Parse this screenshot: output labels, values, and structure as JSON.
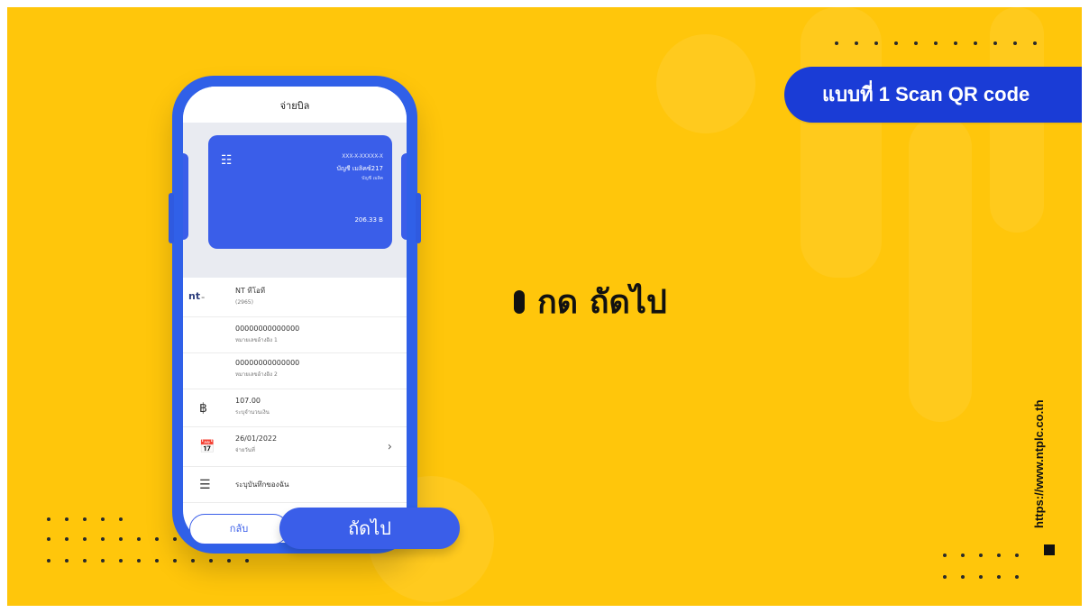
{
  "badge": {
    "prefix": "แบบที่ 1 Scan ",
    "bold": "QR code"
  },
  "instruction": {
    "text": "กด ถัดไป"
  },
  "website": "https://www.ntplc.co.th",
  "phone": {
    "header_title": "จ่ายบิล",
    "card": {
      "account_number": "XXX-X-XXXXX-X",
      "account_name": "บัญชี เมลิคซ์217",
      "account_type": "บัญชี เมลิค",
      "balance": "206.33 B"
    },
    "biller": {
      "name": "NT ทีโอที",
      "code": "(2965)",
      "logo": "nt"
    },
    "ref1": {
      "value": "00000000000000",
      "label": "หมายเลขอ้างอิง 1"
    },
    "ref2": {
      "value": "00000000000000",
      "label": "หมายเลขอ้างอิง 2"
    },
    "amount": {
      "value": "107.00",
      "label": "ระบุจำนวนเงิน"
    },
    "date": {
      "value": "26/01/2022",
      "label": "จ่ายวันที่"
    },
    "note": {
      "label": "ระบุบันทึกของฉัน"
    },
    "back_label": "กลับ",
    "next_label": "ถัดไป"
  }
}
